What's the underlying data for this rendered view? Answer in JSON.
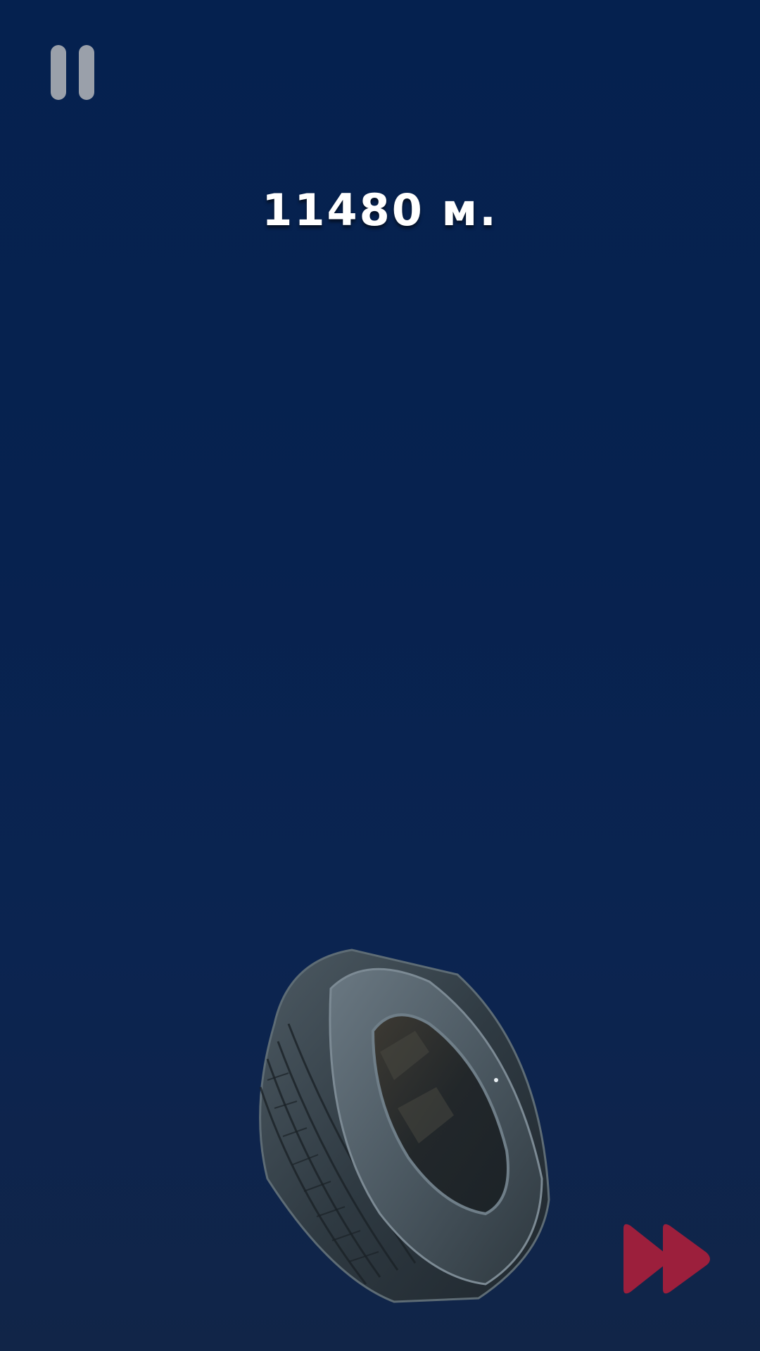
{
  "hud": {
    "distance_text": "11480 м.",
    "pause_icon": "pause-icon",
    "fast_forward_icon": "fast-forward-icon"
  },
  "game": {
    "object": "tire"
  },
  "colors": {
    "background": "#05214f",
    "pause": "#9aa0aa",
    "fast_forward": "#9c1f3c",
    "distance_text": "#ffffff"
  }
}
